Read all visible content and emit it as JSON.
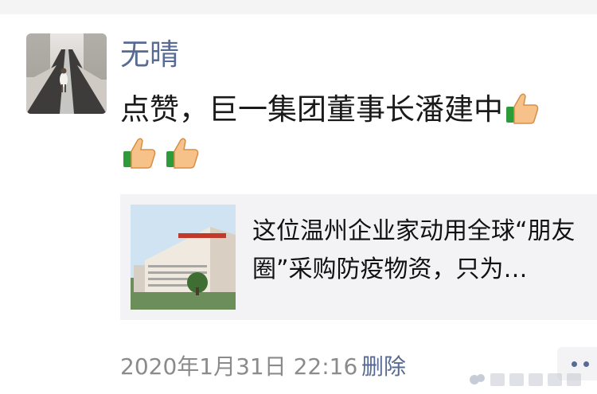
{
  "colors": {
    "name_link": "#576b95",
    "text": "#1a1a1a",
    "meta": "#8b8b8b",
    "card_bg": "#f3f3f5"
  },
  "post": {
    "username": "无晴",
    "text_line1": "点赞，巨一集团董事长潘建中",
    "emoji_icon": "thumbs-up-icon",
    "link_card": {
      "title": "这位温州企业家动用全球“朋友圈”采购防疫物资，只为…",
      "thumbnail_icon": "company-building-thumbnail"
    },
    "timestamp": "2020年1月31日 22:16",
    "delete_label": "删除",
    "more_icon": "more-dots-icon"
  }
}
